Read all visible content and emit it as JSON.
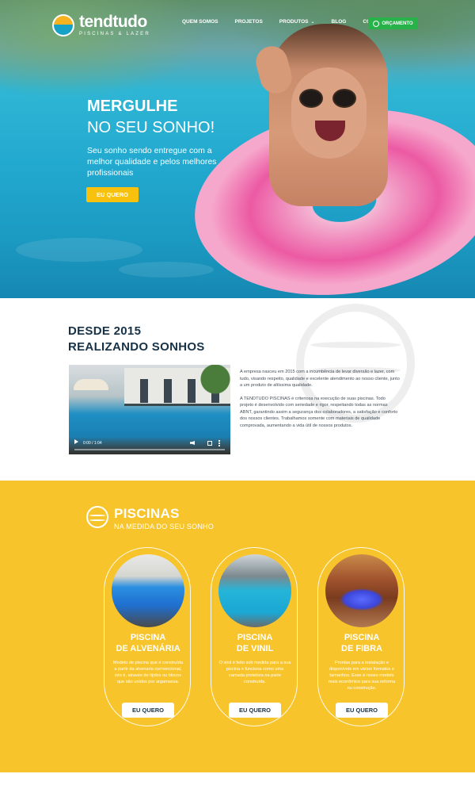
{
  "brand": {
    "name": "tendtudo",
    "tagline": "PISCINAS & LAZER",
    "colors": {
      "yellow": "#f8c42b",
      "navy": "#173247",
      "green": "#27b24a"
    }
  },
  "nav": {
    "items": [
      {
        "label": "QUEM SOMOS"
      },
      {
        "label": "PROJETOS"
      },
      {
        "label": "PRODUTOS"
      },
      {
        "label": "BLOG"
      },
      {
        "label": "CONTATO"
      }
    ],
    "cta_label": "ORÇAMENTO"
  },
  "hero": {
    "title_line1": "MERGULHE",
    "title_line2": "NO SEU SONHO!",
    "subtitle": "Seu sonho sendo entregue com a melhor qualidade e pelos melhores profissionais",
    "button_label": "EU QUERO"
  },
  "about": {
    "heading_line1": "DESDE 2015",
    "heading_line2": "REALIZANDO SONHOS",
    "video_time": "0:00 / 1:04",
    "paragraph1": "A empresa nasceu em 2015 com a incumbência de levar diversão e lazer, com tudo, visando respeito, qualidade e excelente atendimento ao nosso cliente, junto a um produto de altíssima qualidade.",
    "paragraph2": "A TENDTUDO PISCINAS é criteriosa na execução de suas piscinas. Todo projeto é desenvolvido com seriedade e rigor, respeitando todas as normas ABNT, garantindo assim a segurança dos colaboradores, a satisfação e conforto dos nossos clientes. Trabalhamos somente com materiais de qualidade comprovada, aumentando a vida útil de nossos produtos."
  },
  "pools": {
    "title": "PISCINAS",
    "subtitle": "NA MEDIDA DO SEU SONHO",
    "cards": [
      {
        "name_line1": "PISCINA",
        "name_line2": "DE ALVENÁRIA",
        "description": "Modelo de piscina que é construída a partir da alvenaria convencional, isto é, através de tijolos ou blocos que são unidos por argamassa.",
        "button_label": "EU QUERO"
      },
      {
        "name_line1": "PISCINA",
        "name_line2": "DE VINIL",
        "description": "O vinil é feito sob medida para a sua piscina e funciona como uma camada protetora na parte construída.",
        "button_label": "EU QUERO"
      },
      {
        "name_line1": "PISCINA",
        "name_line2": "DE FIBRA",
        "description": "Prontas para a instalação e disponíveis em vários formatos e tamanhos. Esse é nosso modelo mais econômico para sua reforma ou construção.",
        "button_label": "EU QUERO"
      }
    ]
  }
}
